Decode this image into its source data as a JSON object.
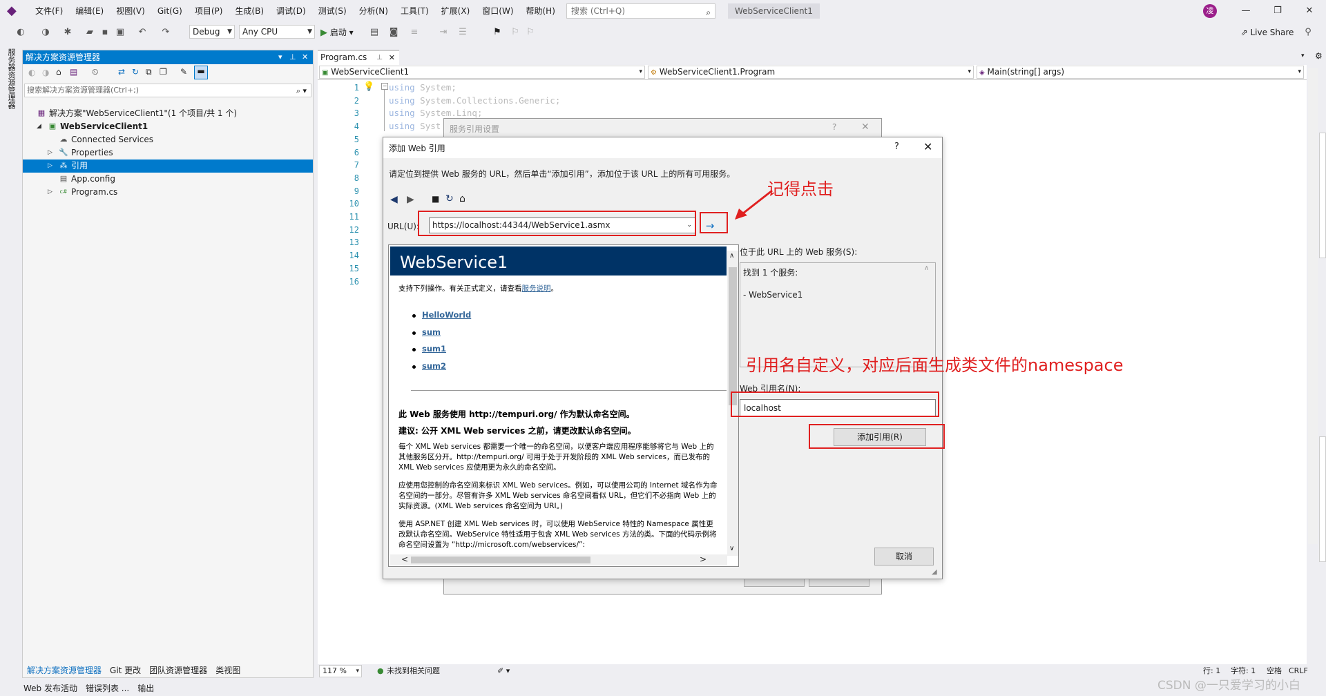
{
  "menu": {
    "items": [
      "文件(F)",
      "编辑(E)",
      "视图(V)",
      "Git(G)",
      "项目(P)",
      "生成(B)",
      "调试(D)",
      "测试(S)",
      "分析(N)",
      "工具(T)",
      "扩展(X)",
      "窗口(W)",
      "帮助(H)"
    ],
    "search_placeholder": "搜索 (Ctrl+Q)",
    "solution_name": "WebServiceClient1",
    "avatar_initial": "凌"
  },
  "toolbar": {
    "config": "Debug",
    "platform": "Any CPU",
    "start_label": "启动",
    "live_share": "Live Share"
  },
  "left_tab": "服务器资源管理器",
  "solution_explorer": {
    "title": "解决方案资源管理器",
    "search_placeholder": "搜索解决方案资源管理器(Ctrl+;)",
    "tree": [
      {
        "label": "解决方案\"WebServiceClient1\"(1 个项目/共 1 个)",
        "level": 0,
        "expander": "",
        "icon": "solution-icon",
        "bold": false,
        "selected": false
      },
      {
        "label": "WebServiceClient1",
        "level": 1,
        "expander": "◢",
        "icon": "csharp-project-icon",
        "bold": true,
        "selected": false
      },
      {
        "label": "Connected Services",
        "level": 2,
        "expander": "",
        "icon": "connected-services-icon",
        "bold": false,
        "selected": false
      },
      {
        "label": "Properties",
        "level": 2,
        "expander": "▷",
        "icon": "wrench-icon",
        "bold": false,
        "selected": false
      },
      {
        "label": "引用",
        "level": 2,
        "expander": "▷",
        "icon": "references-icon",
        "bold": false,
        "selected": true
      },
      {
        "label": "App.config",
        "level": 2,
        "expander": "",
        "icon": "config-file-icon",
        "bold": false,
        "selected": false
      },
      {
        "label": "Program.cs",
        "level": 2,
        "expander": "▷",
        "icon": "csharp-file-icon",
        "bold": false,
        "selected": false
      }
    ],
    "bottom_tabs": [
      "解决方案资源管理器",
      "Git 更改",
      "团队资源管理器",
      "类视图"
    ]
  },
  "bottom_panel_tabs": [
    "Web 发布活动",
    "错误列表 ...",
    "输出"
  ],
  "editor": {
    "tab_label": "Program.cs",
    "nav_project": "WebServiceClient1",
    "nav_class": "WebServiceClient1.Program",
    "nav_member": "Main(string[] args)",
    "line_numbers": [
      "1",
      "2",
      "3",
      "4",
      "5",
      "6",
      "7",
      "8",
      "9",
      "10",
      "11",
      "12",
      "13",
      "14",
      "15",
      "16"
    ],
    "code_lines": [
      {
        "kw": "using",
        "rest": " System;"
      },
      {
        "kw": "using",
        "rest": " System.Collections.Generic;"
      },
      {
        "kw": "using",
        "rest": " System.Linq;"
      },
      {
        "kw": "using",
        "rest": " Syst"
      }
    ],
    "zoom": "117 %",
    "issues": "未找到相关问题",
    "row": "行: 1",
    "col": "字符: 1",
    "spaces": "空格",
    "eol": "CRLF"
  },
  "back_dialog": {
    "title": "服务引用设置",
    "help": "?",
    "close": "✕"
  },
  "dialog": {
    "title": "添加 Web 引用",
    "help": "?",
    "close": "✕",
    "instruction": "请定位到提供 Web 服务的 URL，然后单击“添加引用”，添加位于该 URL 上的所有可用服务。",
    "url_label": "URL(U):",
    "url_value": "https://localhost:44344/WebService1.asmx",
    "go_arrow": "→",
    "services_label": "位于此 URL 上的 Web 服务(S):",
    "services_found": "找到 1 个服务:",
    "service_item": "- WebService1",
    "ref_name_label": "Web 引用名(N):",
    "ref_name_value": "localhost",
    "add_ref_button": "添加引用(R)",
    "cancel_button": "取消"
  },
  "browser": {
    "header": "WebService1",
    "intro": "支持下列操作。有关正式定义，请查看",
    "intro_link": "服务说明",
    "intro_end": "。",
    "operations": [
      "HelloWorld",
      "sum",
      "sum1",
      "sum2"
    ],
    "ns_line": "此  Web 服务使用  http://tempuri.org/ 作为默认命名空间。",
    "advice": "建议: 公开  XML Web services 之前，请更改默认命名空间。",
    "para1": "每个  XML Web services 都需要一个唯一的命名空间，以便客户端应用程序能够将它与 Web 上的其他服务区分开。http://tempuri.org/ 可用于处于开发阶段的  XML Web services，而已发布的  XML Web services 应使用更为永久的命名空间。",
    "para2": "应使用您控制的命名空间来标识  XML Web services。例如，可以使用公司的  Internet 域名作为命名空间的一部分。尽管有许多  XML Web services 命名空间看似  URL，但它们不必指向  Web 上的实际资源。(XML Web services 命名空间为  URI。)",
    "para3": "使用  ASP.NET 创建  XML Web services 时，可以使用  WebService 特性的 Namespace 属性更改默认命名空间。WebService 特性适用于包含  XML Web services 方法的类。下面的代码示例将命名空间设置为 “http://microsoft.com/webservices/”:"
  },
  "annotations": {
    "click_note": "记得点击",
    "ref_note": "引用名自定义，对应后面生成类文件的namespace",
    "color": "#e02020"
  },
  "watermark": "CSDN @一只爱学习的小白"
}
